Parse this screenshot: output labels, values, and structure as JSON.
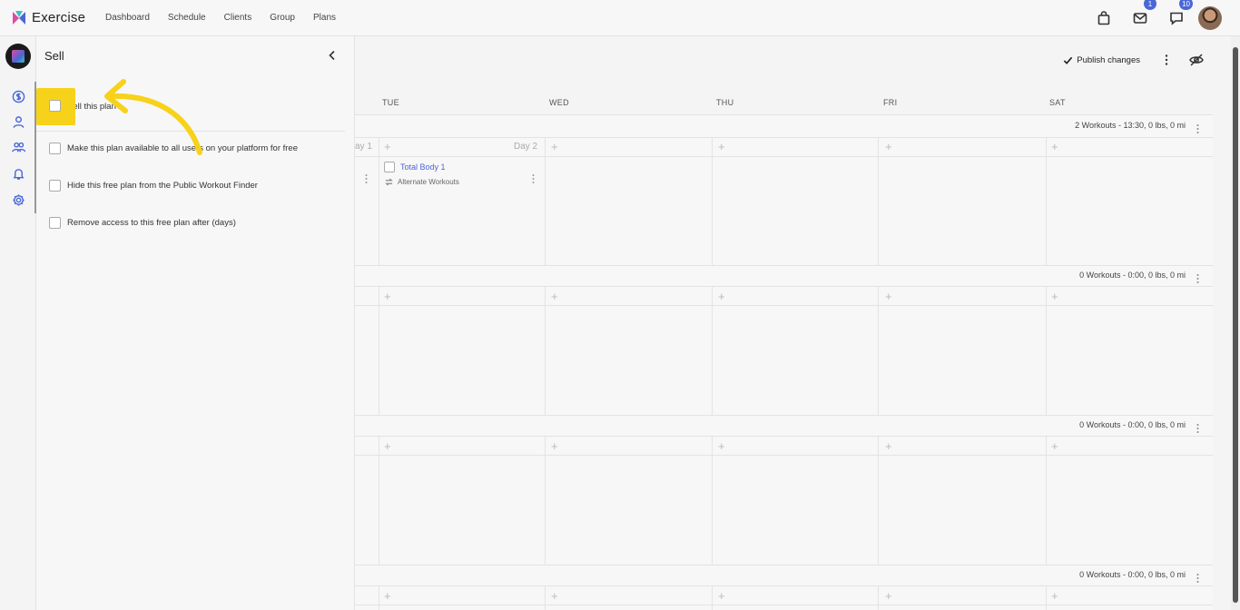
{
  "app": {
    "name": "Exercise"
  },
  "nav": [
    "Dashboard",
    "Schedule",
    "Clients",
    "Group",
    "Plans"
  ],
  "header": {
    "mail_badge": "1",
    "chat_badge": "10"
  },
  "panel": {
    "title": "Sell",
    "options": [
      {
        "label": "Sell this plan"
      },
      {
        "label": "Make this plan available to all users on your platform for free"
      },
      {
        "label": "Hide this free plan from the Public Workout Finder"
      },
      {
        "label": "Remove access to this free plan after (days)"
      }
    ]
  },
  "toolbar": {
    "publish_label": "Publish changes"
  },
  "calendar": {
    "days": [
      "TUE",
      "WED",
      "THU",
      "FRI",
      "SAT"
    ],
    "day_labels": [
      "ay 1",
      "Day 2"
    ],
    "weeks": [
      {
        "summary": "2 Workouts - 13:30, 0 lbs, 0 mi"
      },
      {
        "summary": "0 Workouts - 0:00, 0 lbs, 0 mi"
      },
      {
        "summary": "0 Workouts - 0:00, 0 lbs, 0 mi"
      },
      {
        "summary": "0 Workouts - 0:00, 0 lbs, 0 mi"
      }
    ],
    "workout": {
      "name": "Total Body 1",
      "alt": "Alternate Workouts"
    }
  },
  "colors": {
    "accent": "#4a67d6",
    "highlight": "#f7d21a"
  }
}
